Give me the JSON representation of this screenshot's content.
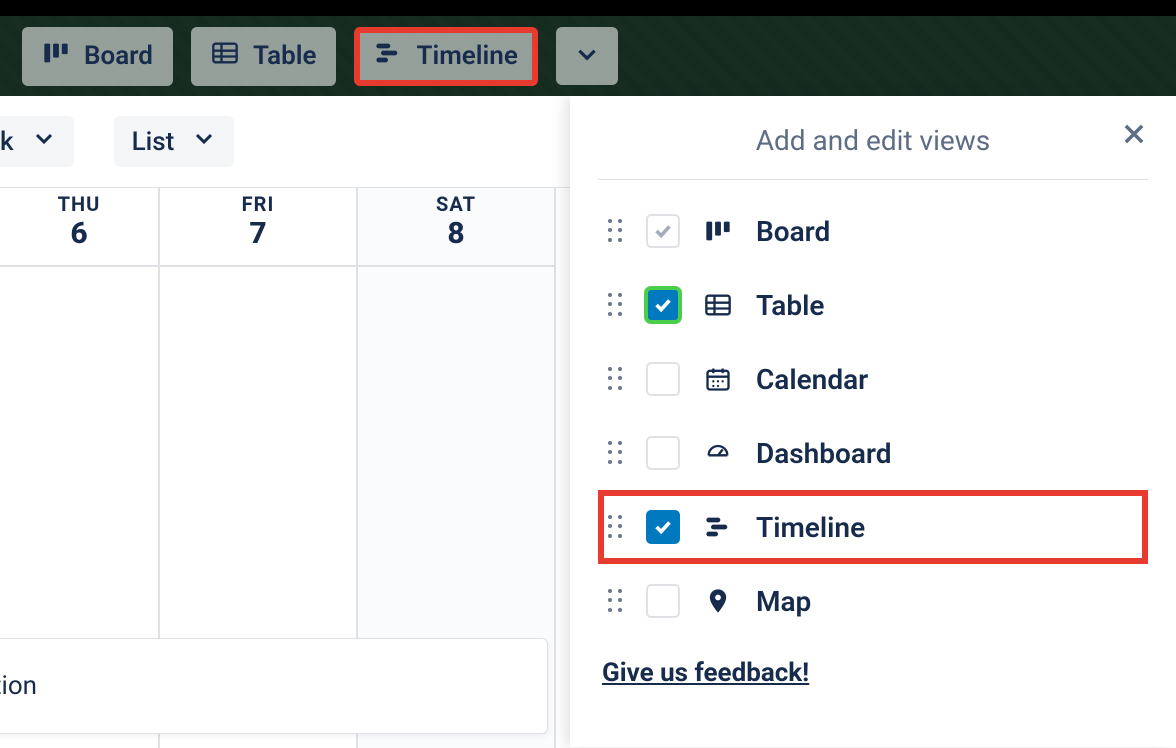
{
  "tabs": {
    "board": "Board",
    "table": "Table",
    "timeline": "Timeline"
  },
  "toolbar": {
    "list_label": "List",
    "prev_half_label": "k"
  },
  "calendar": {
    "days": [
      {
        "dow": "THU",
        "num": "6"
      },
      {
        "dow": "FRI",
        "num": "7"
      },
      {
        "dow": "SAT",
        "num": "8"
      }
    ],
    "card_tail": "tion"
  },
  "panel": {
    "title": "Add and edit views",
    "items": [
      {
        "label": "Board",
        "checked": "disabled"
      },
      {
        "label": "Table",
        "checked": "green"
      },
      {
        "label": "Calendar",
        "checked": "none"
      },
      {
        "label": "Dashboard",
        "checked": "none"
      },
      {
        "label": "Timeline",
        "checked": "blue",
        "highlight": true
      },
      {
        "label": "Map",
        "checked": "none"
      }
    ],
    "feedback": "Give us feedback!"
  }
}
